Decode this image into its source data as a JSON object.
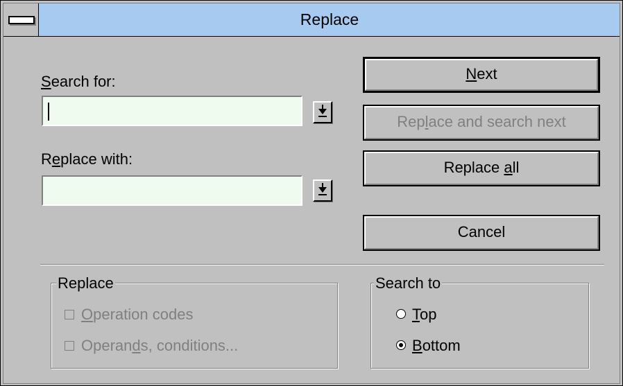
{
  "window": {
    "title": "Replace"
  },
  "search": {
    "label_mnemonic": "S",
    "label_rest": "earch for:",
    "value": ""
  },
  "replace": {
    "label_pre": "R",
    "label_mnemonic": "e",
    "label_rest": "place with:",
    "value": ""
  },
  "buttons": {
    "next": {
      "pre": "",
      "mnemonic": "N",
      "post": "ext"
    },
    "replace_next": {
      "pre": "Rep",
      "mnemonic": "l",
      "post": "ace and search next"
    },
    "replace_all": {
      "pre": "Replace ",
      "mnemonic": "a",
      "post": "ll"
    },
    "cancel": "Cancel"
  },
  "replace_group": {
    "title": "Replace",
    "opcodes": {
      "pre": "",
      "mnemonic": "O",
      "post": "peration codes",
      "checked": false
    },
    "operands": {
      "pre": "Operan",
      "mnemonic": "d",
      "post": "s, conditions...",
      "checked": false
    }
  },
  "search_group": {
    "title": "Search to",
    "top": {
      "mnemonic": "T",
      "post": "op",
      "selected": false
    },
    "bottom": {
      "mnemonic": "B",
      "post": "ottom",
      "selected": true
    }
  },
  "icons": {
    "system_menu": "system-menu-icon",
    "dropdown": "dropdown-arrow-icon"
  }
}
